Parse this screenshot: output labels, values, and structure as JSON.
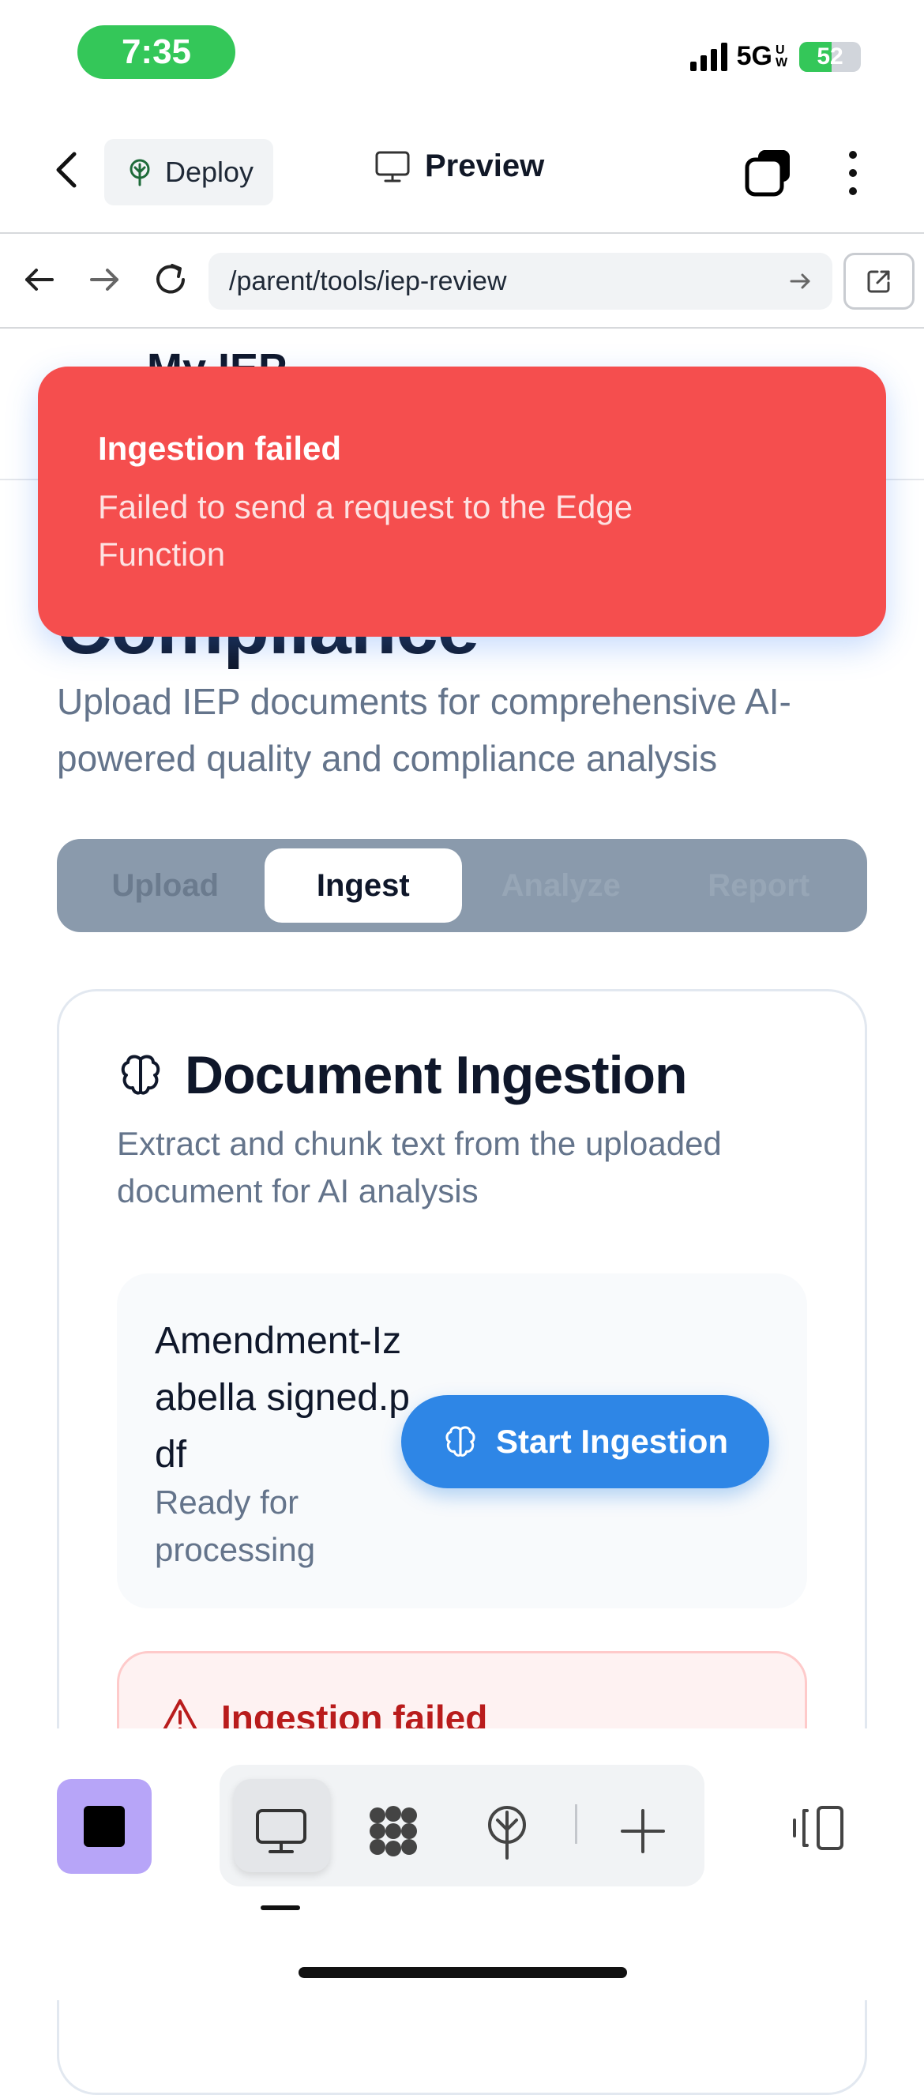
{
  "status_bar": {
    "time": "7:35",
    "network": "5G",
    "network_sub": "UW",
    "battery": "52"
  },
  "app_bar": {
    "deploy_label": "Deploy",
    "preview_label": "Preview"
  },
  "browser": {
    "url": "/parent/tools/iep-review"
  },
  "page": {
    "title_top": "My IEP",
    "title_big": "Compliance",
    "subtitle": "Upload IEP documents for comprehensive AI-powered quality and compliance analysis",
    "steps": [
      {
        "label": "Upload",
        "state": "inactive"
      },
      {
        "label": "Ingest",
        "state": "active"
      },
      {
        "label": "Analyze",
        "state": "disabled"
      },
      {
        "label": "Report",
        "state": "disabled"
      }
    ]
  },
  "card": {
    "title": "Document Ingestion",
    "subtitle": "Extract and chunk text from the uploaded document for AI analysis",
    "file_name": "Amendment-Izabella signed.pdf",
    "file_status": "Ready for processing",
    "start_button": "Start Ingestion",
    "error_title": "Ingestion failed"
  },
  "toast": {
    "title": "Ingestion failed",
    "message": "Failed to send a request to the Edge Function"
  },
  "colors": {
    "toast": "#f54e4e",
    "primary_button": "#2e86e6",
    "status_pill": "#34c759",
    "stepper": "#8a9aac",
    "app_square": "#b7a5f8"
  },
  "icons": {
    "deploy": "tree-icon",
    "preview": "monitor-icon",
    "card": "brain-icon",
    "error": "warning-triangle-icon",
    "tabs": "tabs-icon",
    "more": "more-vertical-icon"
  }
}
